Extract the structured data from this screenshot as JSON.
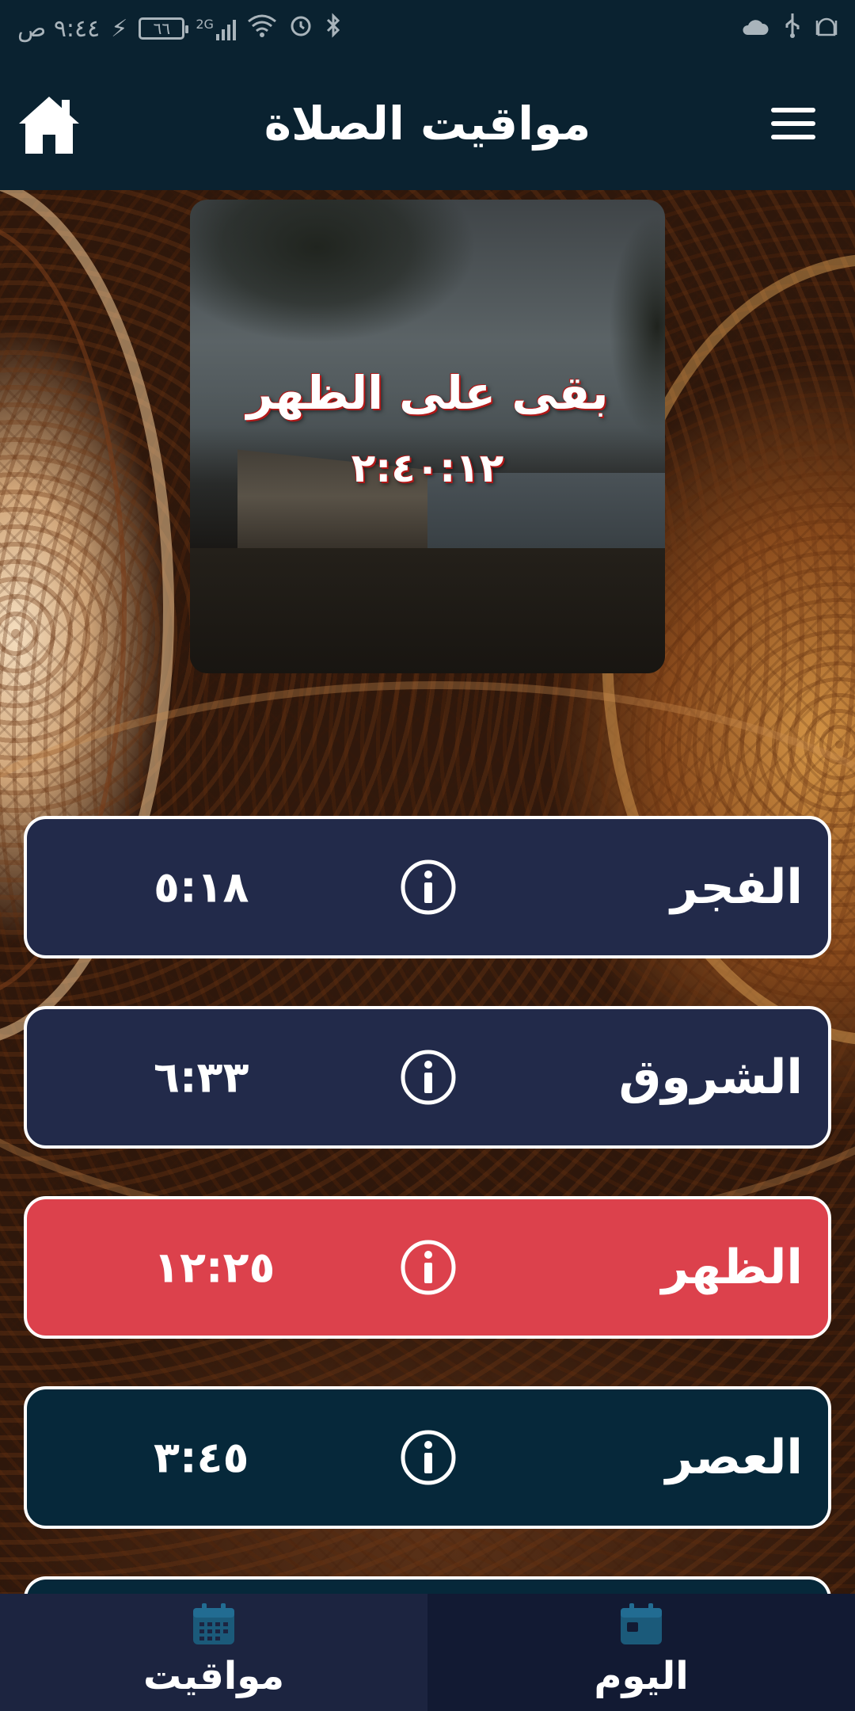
{
  "status_bar": {
    "time": "٩:٤٤ ص",
    "battery": "٦٦",
    "network": "2G"
  },
  "app_bar": {
    "title": "مواقيت الصلاة"
  },
  "countdown": {
    "label": "بقى على الظهر",
    "time": "٢:٤٠:١٢"
  },
  "prayers": [
    {
      "name": "الفجر",
      "time": "٥:١٨",
      "color": "#222a4a",
      "highlighted": false
    },
    {
      "name": "الشروق",
      "time": "٦:٣٣",
      "color": "#222a4a",
      "highlighted": false
    },
    {
      "name": "الظهر",
      "time": "١٢:٢٥",
      "color": "#dc414c",
      "highlighted": true
    },
    {
      "name": "العصر",
      "time": "٣:٤٥",
      "color": "#06283a",
      "highlighted": false
    }
  ],
  "bottom_nav": {
    "items": [
      {
        "label": "مواقيت",
        "icon": "calendar-grid-icon",
        "bg": "#1c2440"
      },
      {
        "label": "اليوم",
        "icon": "calendar-day-icon",
        "bg": "#121a33"
      }
    ]
  },
  "colors": {
    "app_bar": "#0a2230",
    "icon_accent": "#1b5a7a",
    "highlight_text_shadow": "#b01818"
  }
}
